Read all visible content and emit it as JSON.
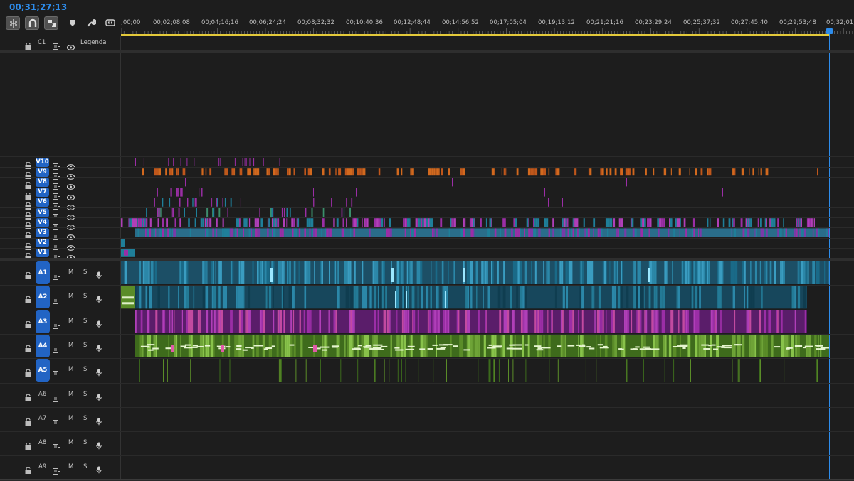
{
  "timecode": "00;31;27;13",
  "toolbar": {
    "icons": [
      "insert-snap-icon",
      "magnet-icon",
      "linked-selection-icon",
      "marker-icon",
      "wrench-icon",
      "captions-icon"
    ]
  },
  "ruler": {
    "labels": [
      ";00;00",
      "00;02;08;08",
      "00;04;16;16",
      "00;06;24;24",
      "00;08;32;32",
      "00;10;40;36",
      "00;12;48;44",
      "00;14;56;52",
      "00;17;05;04",
      "00;19;13;12",
      "00;21;21;16",
      "00;23;29;24",
      "00;25;37;32",
      "00;27;45;40",
      "00;29;53;48",
      "00;32;01;"
    ]
  },
  "caption_track": {
    "id": "C1",
    "name": "Legenda"
  },
  "video_tracks": [
    "V10",
    "V9",
    "V8",
    "V7",
    "V6",
    "V5",
    "V4",
    "V3",
    "V2",
    "V1"
  ],
  "audio_tracks": [
    {
      "id": "A1",
      "targeted": true
    },
    {
      "id": "A2",
      "targeted": true
    },
    {
      "id": "A3",
      "targeted": true
    },
    {
      "id": "A4",
      "targeted": true
    },
    {
      "id": "A5",
      "targeted": true
    },
    {
      "id": "A6",
      "targeted": false
    },
    {
      "id": "A7",
      "targeted": false
    },
    {
      "id": "A8",
      "targeted": false
    },
    {
      "id": "A9",
      "targeted": false
    }
  ],
  "audio_buttons": {
    "mute": "M",
    "solo": "S"
  },
  "colors": {
    "accent": "#2d8ceb",
    "badge": "#2264c4",
    "v9": "#c0571b",
    "magenta": "#9b2ea6",
    "teal": "#1f7f99",
    "green": "#5a8c28",
    "yellow": "#e3c93a"
  }
}
